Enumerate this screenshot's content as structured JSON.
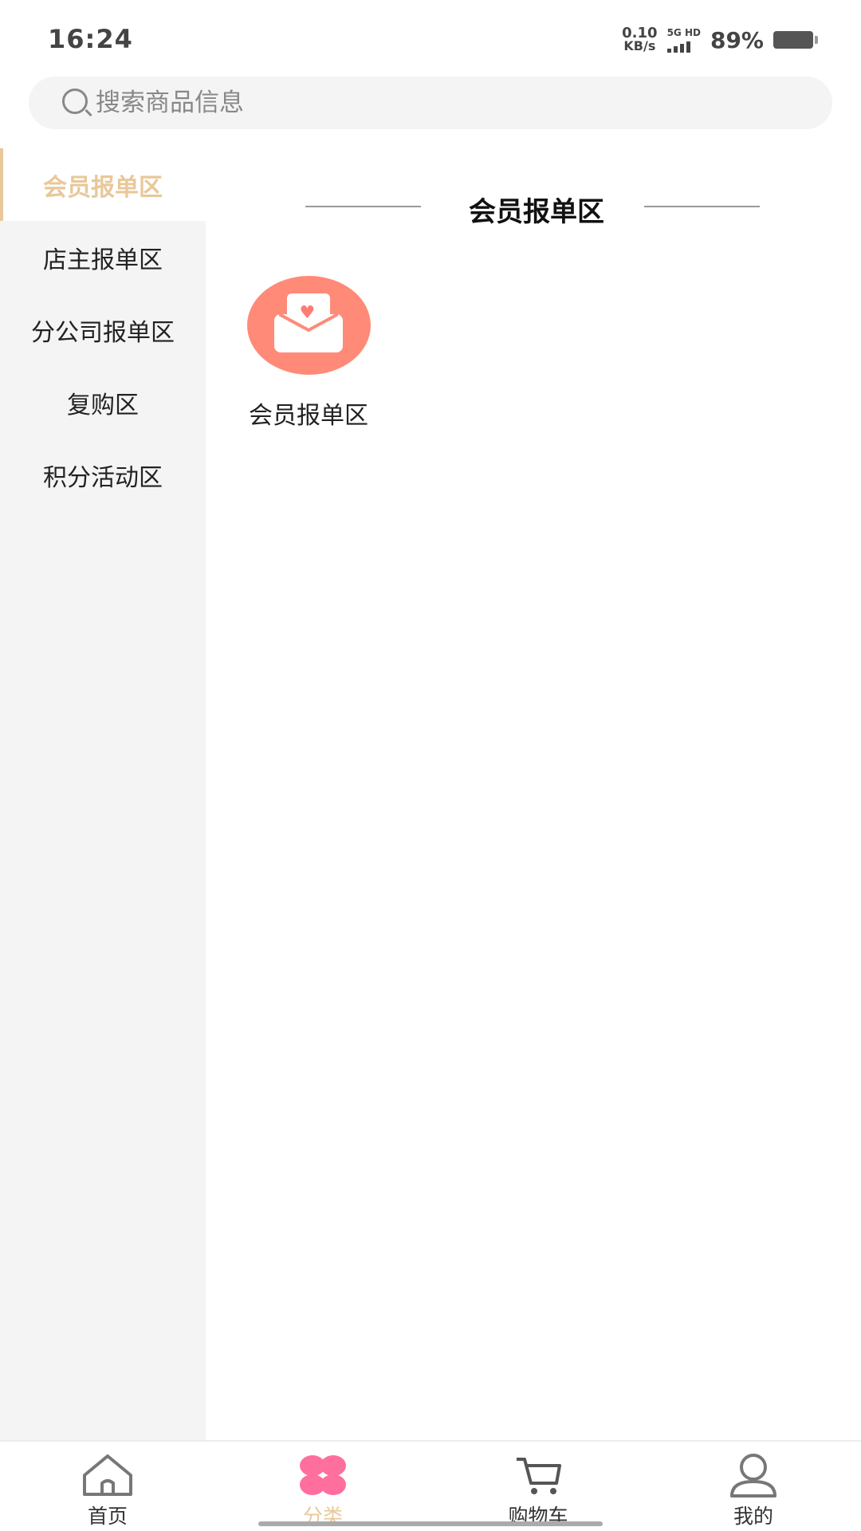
{
  "status_bar": {
    "time": "16:24",
    "net_speed_value": "0.10",
    "net_speed_unit": "KB/s",
    "signal_label": "5G HD",
    "battery": "89%"
  },
  "search": {
    "placeholder": "搜索商品信息"
  },
  "sidebar": {
    "items": [
      {
        "label": "会员报单区",
        "active": true
      },
      {
        "label": "店主报单区",
        "active": false
      },
      {
        "label": "分公司报单区",
        "active": false
      },
      {
        "label": "复购区",
        "active": false
      },
      {
        "label": "积分活动区",
        "active": false
      }
    ]
  },
  "content": {
    "section_title": "会员报单区",
    "categories": [
      {
        "label": "会员报单区",
        "icon": "envelope-heart-icon"
      }
    ]
  },
  "bottom_nav": {
    "items": [
      {
        "label": "首页",
        "icon": "home-icon",
        "active": false
      },
      {
        "label": "分类",
        "icon": "clover-icon",
        "active": true
      },
      {
        "label": "购物车",
        "icon": "cart-icon",
        "active": false
      },
      {
        "label": "我的",
        "icon": "user-icon",
        "active": false
      }
    ]
  },
  "colors": {
    "accent": "#e8c89a",
    "icon_bg": "#ff8a78",
    "clover": "#ff6f9e"
  }
}
